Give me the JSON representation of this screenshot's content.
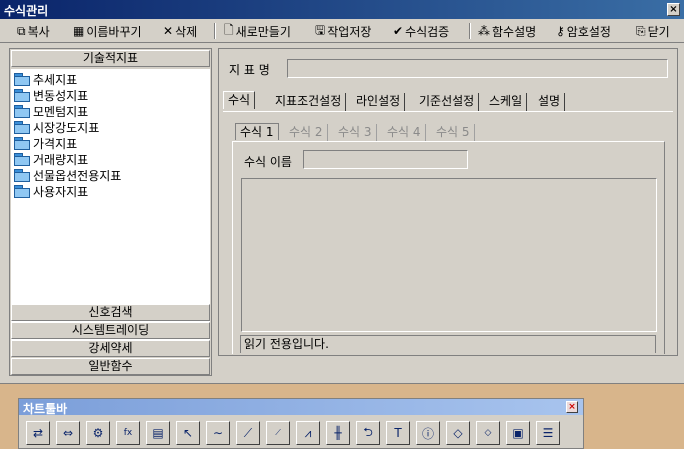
{
  "window": {
    "title": "수식관리",
    "close": "×"
  },
  "toolbar": {
    "copy": "복사",
    "rename": "이름바꾸기",
    "delete": "삭제",
    "new": "새로만들기",
    "save": "작업저장",
    "verify": "수식검증",
    "func_help": "함수설명",
    "password": "암호설정",
    "close": "닫기"
  },
  "left": {
    "header": "기술적지표",
    "tree": [
      "추세지표",
      "변동성지표",
      "모멘텀지표",
      "시장강도지표",
      "가격지표",
      "거래량지표",
      "선물옵션전용지표",
      "사용자지표"
    ],
    "bottom": [
      "신호검색",
      "시스템트레이딩",
      "강세약세",
      "일반함수"
    ]
  },
  "right": {
    "indicator_label": "지 표 명",
    "tabs": [
      "수식",
      "지표조건설정",
      "라인설정",
      "기준선설정",
      "스케일",
      "설명"
    ],
    "subtabs": [
      "수식 1",
      "수식 2",
      "수식 3",
      "수식 4",
      "수식 5"
    ],
    "formula_name_label": "수식 이름",
    "status": "읽기 전용입니다."
  },
  "chart_toolbar": {
    "title": "차트툴바",
    "close": "×"
  }
}
